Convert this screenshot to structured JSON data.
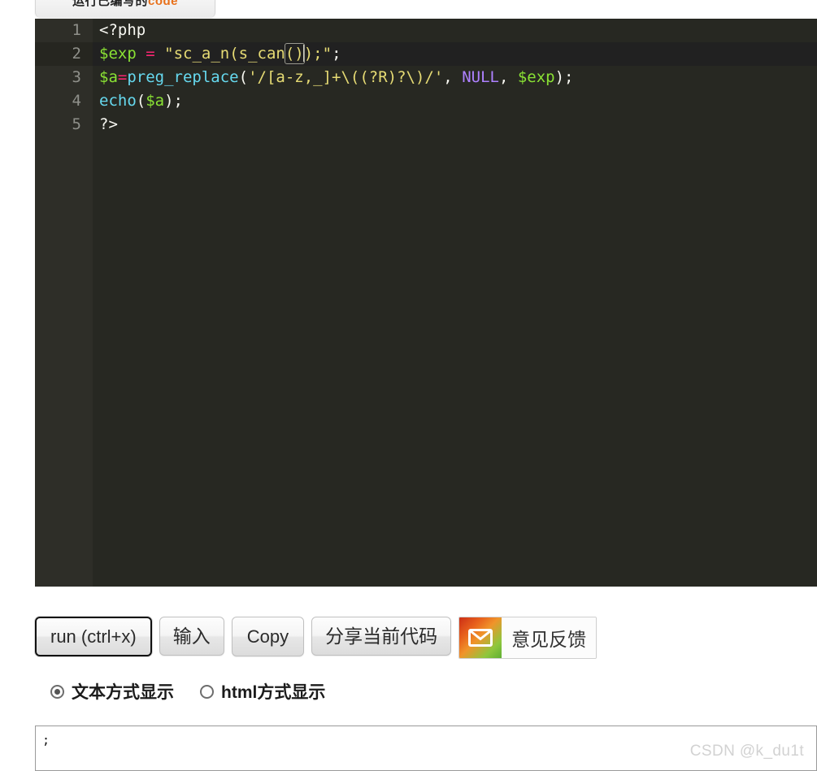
{
  "tab": {
    "label_prefix": "运行已编写的",
    "label_accent": "code"
  },
  "editor": {
    "theme_bg": "#272822",
    "gutter_bg": "#2e2e28",
    "active_line_bg": "#212121",
    "active_line": 2,
    "lines": [
      {
        "number": "1",
        "text": "<?php"
      },
      {
        "number": "2",
        "text": "$exp = \"sc_a_n(s_can());\";"
      },
      {
        "number": "3",
        "text": "$a=preg_replace('/[a-z,_]+\\((?R)?\\)/', NULL, $exp);"
      },
      {
        "number": "4",
        "text": "echo($a);"
      },
      {
        "number": "5",
        "text": "?>"
      }
    ]
  },
  "toolbar": {
    "run_label": "run (ctrl+x)",
    "input_label": "输入",
    "copy_label": "Copy",
    "share_label": "分享当前代码",
    "feedback_label": "意见反馈",
    "feedback_icon": "envelope-icon"
  },
  "display_mode": {
    "options": [
      {
        "label": "文本方式显示",
        "selected": true
      },
      {
        "label": "html方式显示",
        "selected": false
      }
    ]
  },
  "output": {
    "text": ";"
  },
  "watermark": {
    "text": "CSDN @k_du1t"
  }
}
